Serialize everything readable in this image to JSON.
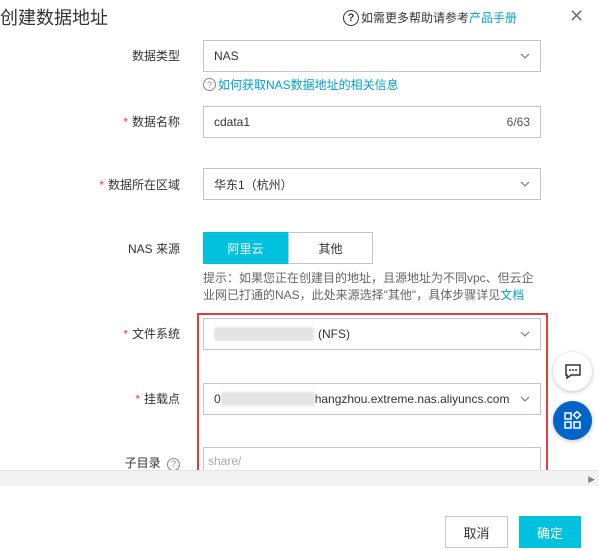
{
  "dialog": {
    "title": "创建数据地址",
    "help_prefix": "如需更多帮助请参考",
    "help_link": "产品手册",
    "close_icon": "close-icon"
  },
  "form": {
    "data_type": {
      "label": "数据类型",
      "value": "NAS"
    },
    "data_type_hint": "如何获取NAS数据地址的相关信息",
    "data_name": {
      "label": "数据名称",
      "value": "cdata1",
      "counter": "6/63"
    },
    "region": {
      "label": "数据所在区域",
      "value": "华东1（杭州）"
    },
    "nas_source": {
      "label": "NAS 来源",
      "options": [
        "阿里云",
        "其他"
      ],
      "selected": "阿里云",
      "tip": "提示：如果您正在创建目的地址，且源地址为不同vpc、但云企业网已打通的NAS，此处来源选择\"其他\"，具体步骤详见",
      "tip_link": "文档"
    },
    "file_system": {
      "label": "文件系统",
      "value_suffix": "(NFS)"
    },
    "mount_point": {
      "label": "挂载点",
      "value_prefix": "0",
      "value_suffix": "hangzhou.extreme.nas.aliyuncs.com"
    },
    "sub_dir": {
      "label": "子目录",
      "placeholder": "share/"
    }
  },
  "footer": {
    "cancel": "取消",
    "confirm": "确定"
  },
  "colors": {
    "accent": "#00c1de",
    "link": "#00a2ca",
    "required": "#e73c3c",
    "highlight": "#e63c3c",
    "float_blue": "#0064c8"
  }
}
